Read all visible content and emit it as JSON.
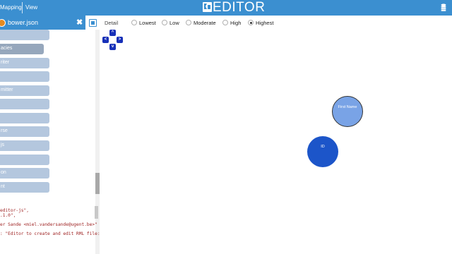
{
  "topbar": {
    "menu": [
      "Mapping",
      "View"
    ],
    "logo_text": "EDITOR",
    "db_icon": "database-icon"
  },
  "file_tab": {
    "name": "bower.json",
    "close": "✖",
    "add_icon": "add-tab-icon"
  },
  "dependency_list": [
    {
      "label": ""
    },
    {
      "label": "acies"
    },
    {
      "label": "riter"
    },
    {
      "label": ""
    },
    {
      "label": "mitter"
    },
    {
      "label": ""
    },
    {
      "label": ""
    },
    {
      "label": "rse"
    },
    {
      "label": "js"
    },
    {
      "label": ""
    },
    {
      "label": "on"
    },
    {
      "label": "nt"
    }
  ],
  "code_lines": [
    "editor-js\",",
    ".1.0\",",
    "er Sande <miel.vandersande@ugent.be>\"",
    ": \"Editor to create and edit RML file:"
  ],
  "detail": {
    "label": "Detail",
    "options": [
      {
        "label": "Lowest",
        "selected": false
      },
      {
        "label": "Low",
        "selected": false
      },
      {
        "label": "Moderate",
        "selected": false
      },
      {
        "label": "High",
        "selected": false
      },
      {
        "label": "Highest",
        "selected": true
      }
    ]
  },
  "nav": {
    "up": "^",
    "left": "<",
    "right": ">",
    "down": "v"
  },
  "graph": {
    "nodes": [
      {
        "label": "First Name",
        "style": "light"
      },
      {
        "label": "ID",
        "style": "dark"
      }
    ]
  },
  "colors": {
    "topbar": "#3b8fd0",
    "list_item": "#b4c7de",
    "list_item_selected": "#96a7bc",
    "nav_button": "#1730b8",
    "node_light": "#79a3e6",
    "node_dark": "#1c55c9",
    "code_text": "#9d1f1f"
  }
}
